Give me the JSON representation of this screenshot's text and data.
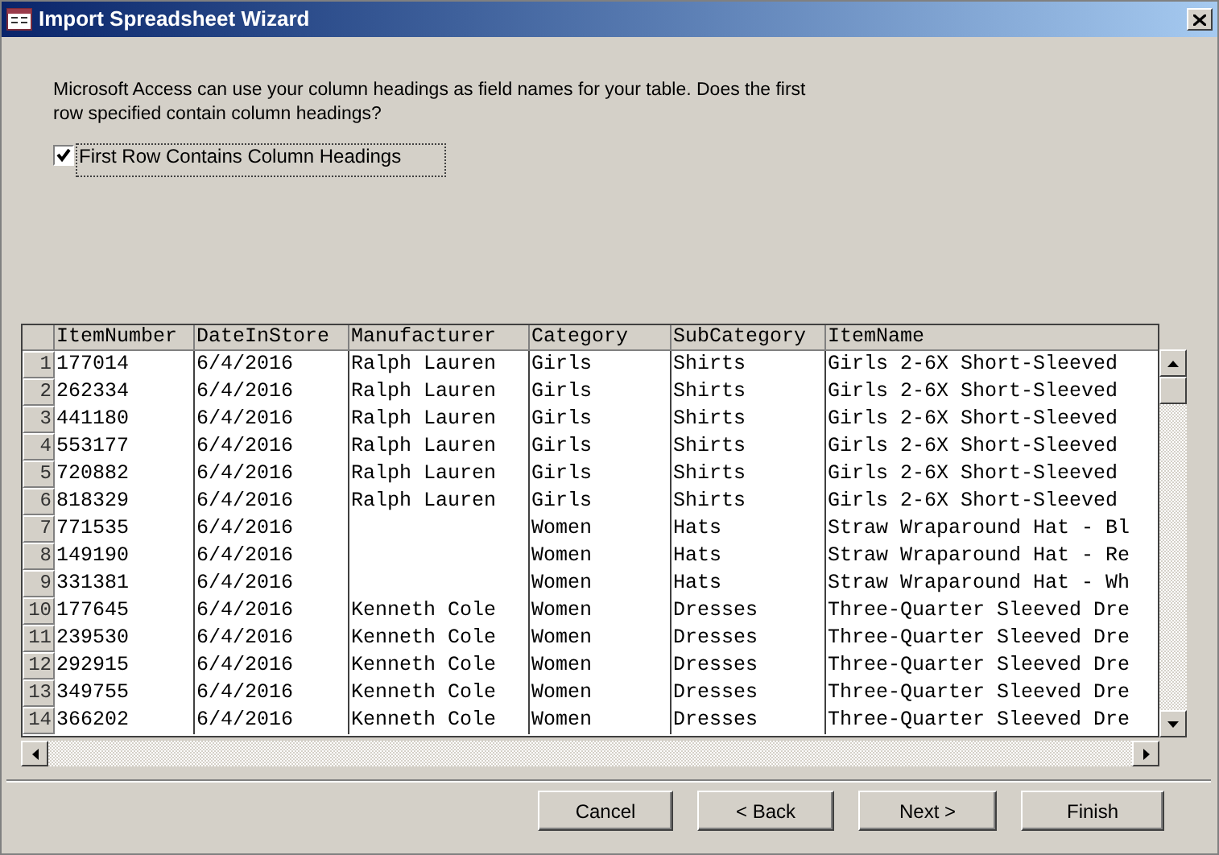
{
  "window": {
    "title": "Import Spreadsheet Wizard"
  },
  "prompt": "Microsoft Access can use your column headings as field names for your table. Does the first row specified contain column headings?",
  "first_row_headings": {
    "label": "First Row Contains Column Headings",
    "checked": true
  },
  "table": {
    "columns": [
      "ItemNumber",
      "DateInStore",
      "Manufacturer",
      "Category",
      "SubCategory",
      "ItemName"
    ],
    "rows": [
      {
        "number": "1",
        "cells": [
          "177014",
          "6/4/2016",
          "Ralph Lauren",
          "Girls",
          "Shirts",
          "Girls 2-6X Short-Sleeved"
        ]
      },
      {
        "number": "2",
        "cells": [
          "262334",
          "6/4/2016",
          "Ralph Lauren",
          "Girls",
          "Shirts",
          "Girls 2-6X Short-Sleeved"
        ]
      },
      {
        "number": "3",
        "cells": [
          "441180",
          "6/4/2016",
          "Ralph Lauren",
          "Girls",
          "Shirts",
          "Girls 2-6X Short-Sleeved"
        ]
      },
      {
        "number": "4",
        "cells": [
          "553177",
          "6/4/2016",
          "Ralph Lauren",
          "Girls",
          "Shirts",
          "Girls 2-6X Short-Sleeved"
        ]
      },
      {
        "number": "5",
        "cells": [
          "720882",
          "6/4/2016",
          "Ralph Lauren",
          "Girls",
          "Shirts",
          "Girls 2-6X Short-Sleeved"
        ]
      },
      {
        "number": "6",
        "cells": [
          "818329",
          "6/4/2016",
          "Ralph Lauren",
          "Girls",
          "Shirts",
          "Girls 2-6X Short-Sleeved"
        ]
      },
      {
        "number": "7",
        "cells": [
          "771535",
          "6/4/2016",
          "",
          "Women",
          "Hats",
          "Straw Wraparound Hat - Bl"
        ]
      },
      {
        "number": "8",
        "cells": [
          "149190",
          "6/4/2016",
          "",
          "Women",
          "Hats",
          "Straw Wraparound Hat - Re"
        ]
      },
      {
        "number": "9",
        "cells": [
          "331381",
          "6/4/2016",
          "",
          "Women",
          "Hats",
          "Straw Wraparound Hat - Wh"
        ]
      },
      {
        "number": "10",
        "cells": [
          "177645",
          "6/4/2016",
          "Kenneth Cole",
          "Women",
          "Dresses",
          "Three-Quarter Sleeved Dre"
        ]
      },
      {
        "number": "11",
        "cells": [
          "239530",
          "6/4/2016",
          "Kenneth Cole",
          "Women",
          "Dresses",
          "Three-Quarter Sleeved Dre"
        ]
      },
      {
        "number": "12",
        "cells": [
          "292915",
          "6/4/2016",
          "Kenneth Cole",
          "Women",
          "Dresses",
          "Three-Quarter Sleeved Dre"
        ]
      },
      {
        "number": "13",
        "cells": [
          "349755",
          "6/4/2016",
          "Kenneth Cole",
          "Women",
          "Dresses",
          "Three-Quarter Sleeved Dre"
        ]
      },
      {
        "number": "14",
        "cells": [
          "366202",
          "6/4/2016",
          "Kenneth Cole",
          "Women",
          "Dresses",
          "Three-Quarter Sleeved Dre"
        ]
      }
    ]
  },
  "buttons": [
    {
      "label": "Cancel"
    },
    {
      "label": "< Back"
    },
    {
      "label": "Next >"
    },
    {
      "label": "Finish"
    }
  ]
}
